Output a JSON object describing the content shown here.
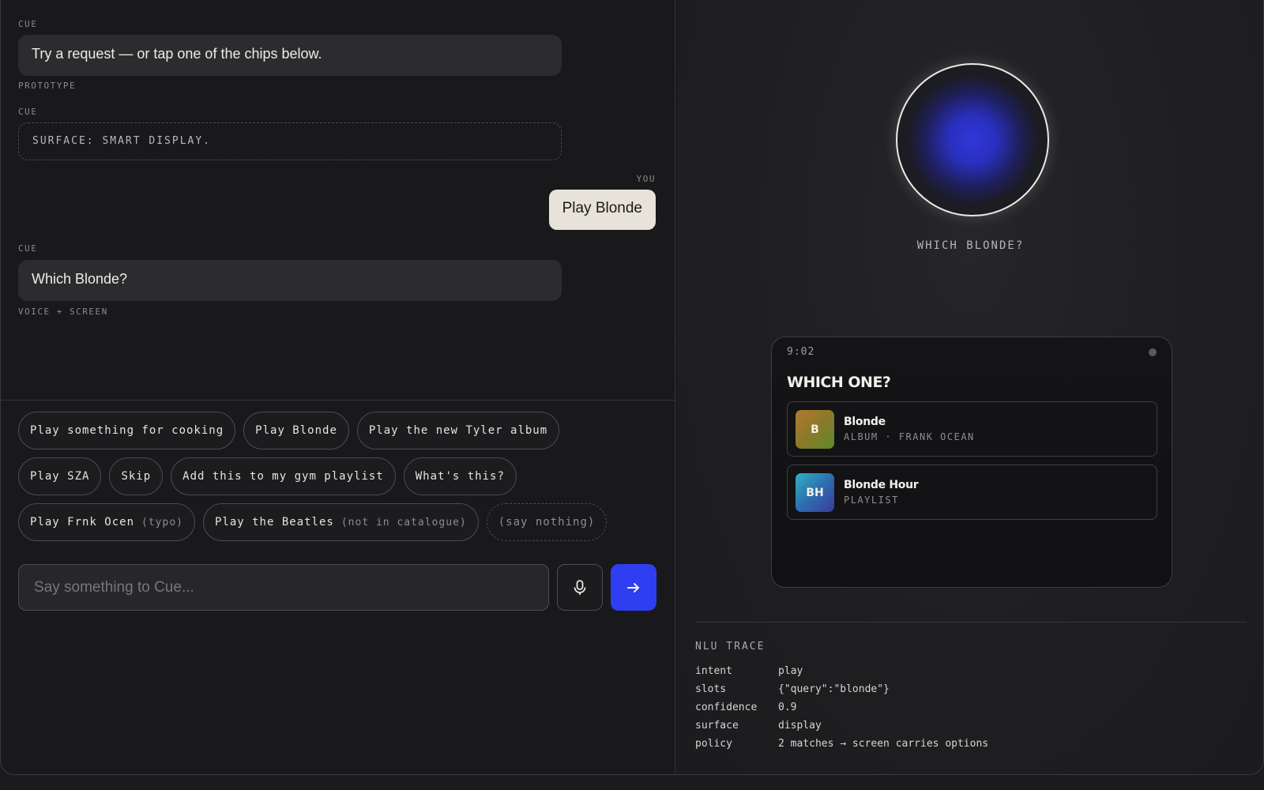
{
  "conversation": {
    "messages": [
      {
        "speaker": "Cue",
        "text": "Try a request — or tap one of the chips below.",
        "tag": "Prototype"
      },
      {
        "speaker": "Cue",
        "text": "Surface: Smart display."
      },
      {
        "speaker": "You",
        "text": "Play Blonde"
      },
      {
        "speaker": "Cue",
        "text": "Which Blonde?",
        "tag": "Voice + screen"
      }
    ]
  },
  "chips": {
    "rows": [
      [
        {
          "label": "Play something for cooking"
        },
        {
          "label": "Play Blonde"
        },
        {
          "label": "Play the new Tyler album"
        }
      ],
      [
        {
          "label": "Play SZA"
        },
        {
          "label": "Skip"
        },
        {
          "label": "Add this to my gym playlist"
        },
        {
          "label": "What's this?"
        }
      ],
      [
        {
          "label": "Play Frnk Ocen",
          "hint": "(typo)"
        },
        {
          "label": "Play the Beatles",
          "hint": "(not in catalogue)"
        },
        {
          "label": "(say nothing)"
        }
      ]
    ]
  },
  "composer": {
    "placeholder": "Say something to Cue...",
    "mic_icon": "microphone-icon",
    "send_icon": "arrow-right-icon",
    "send_color": "#2f3ef0"
  },
  "assistant": {
    "orb_color": "#2a2fbf",
    "caption": "Which Blonde?"
  },
  "device": {
    "time": "9:02",
    "title": "WHICH ONE?",
    "options": [
      {
        "initials": "B",
        "title": "Blonde",
        "subtitle": "Album · Frank Ocean"
      },
      {
        "initials": "BH",
        "title": "Blonde Hour",
        "subtitle": "Playlist"
      }
    ]
  },
  "nlu_trace": {
    "title": "NLU TRACE",
    "rows": [
      {
        "key": "intent",
        "value": "play"
      },
      {
        "key": "slots",
        "value": "{\"query\":\"blonde\"}"
      },
      {
        "key": "confidence",
        "value": "0.9"
      },
      {
        "key": "surface",
        "value": "display"
      },
      {
        "key": "policy",
        "value": "2 matches → screen carries options"
      }
    ]
  }
}
